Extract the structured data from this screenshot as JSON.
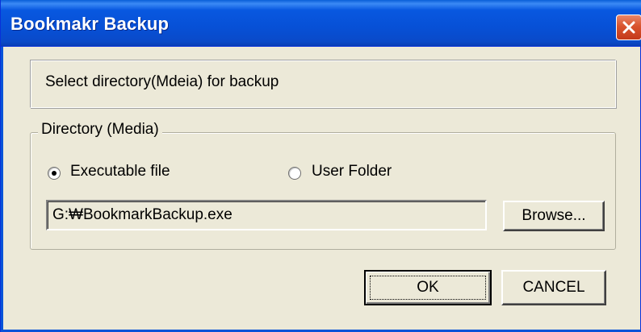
{
  "window": {
    "title": "Bookmakr Backup"
  },
  "info": {
    "text": "Select directory(Mdeia) for backup"
  },
  "directory_group": {
    "legend": "Directory (Media)",
    "options": [
      {
        "label": "Executable file",
        "selected": true
      },
      {
        "label": "User Folder",
        "selected": false
      }
    ],
    "path_value": "G:₩BookmarkBackup.exe",
    "browse_label": "Browse..."
  },
  "buttons": {
    "ok_label": "OK",
    "cancel_label": "CANCEL"
  },
  "colors": {
    "titlebar": "#0750d6",
    "close_button": "#d9542e",
    "dialog_bg": "#ece9d8"
  },
  "icons": {
    "close": "close-icon"
  }
}
